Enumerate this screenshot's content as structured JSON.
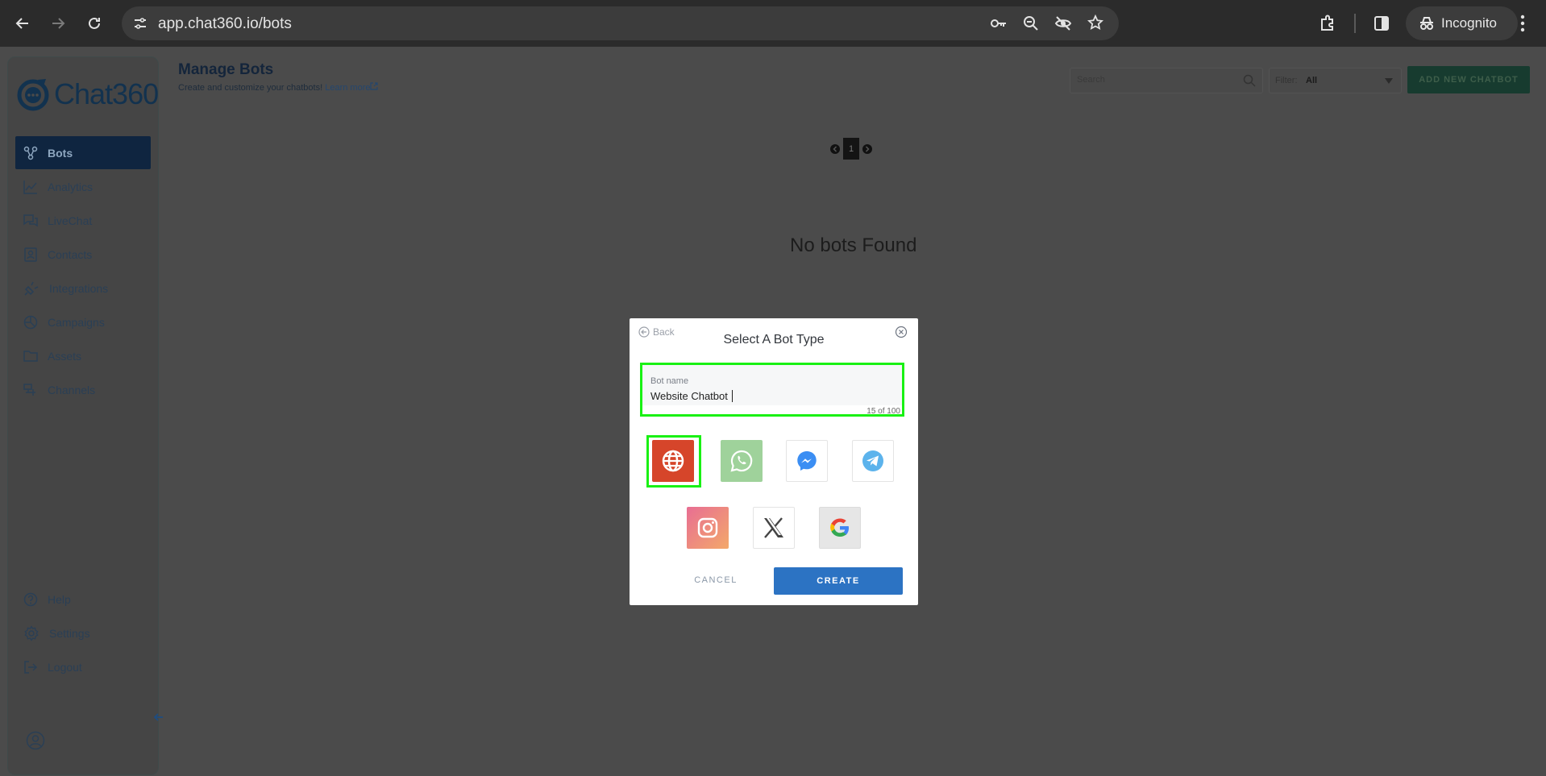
{
  "browser": {
    "url": "app.chat360.io/bots",
    "profile_label": "Incognito"
  },
  "brand": {
    "logo_text": "Chat360"
  },
  "sidebar": {
    "items": [
      {
        "label": "Bots",
        "icon": "bots-icon"
      },
      {
        "label": "Analytics",
        "icon": "analytics-icon"
      },
      {
        "label": "LiveChat",
        "icon": "livechat-icon"
      },
      {
        "label": "Contacts",
        "icon": "contacts-icon"
      },
      {
        "label": "Integrations",
        "icon": "plug-icon"
      },
      {
        "label": "Campaigns",
        "icon": "campaigns-icon"
      },
      {
        "label": "Assets",
        "icon": "folder-icon"
      },
      {
        "label": "Channels",
        "icon": "channels-icon"
      }
    ],
    "bottom_items": [
      {
        "label": "Help",
        "icon": "help-icon"
      },
      {
        "label": "Settings",
        "icon": "gear-icon"
      },
      {
        "label": "Logout",
        "icon": "logout-icon"
      }
    ]
  },
  "header": {
    "title": "Manage Bots",
    "subtitle": "Create and customize your chatbots!",
    "learn_more": "Learn more",
    "search_placeholder": "Search",
    "filter_label": "Filter:",
    "filter_value": "All",
    "add_button": "ADD NEW CHATBOT"
  },
  "pager": {
    "current_page": "1"
  },
  "main": {
    "empty_message": "No bots Found"
  },
  "modal": {
    "back_label": "Back",
    "title": "Select A Bot Type",
    "bot_name_label": "Bot name",
    "bot_name_value": "Website Chatbot",
    "char_count": "15 of 100",
    "bot_types": [
      "website",
      "whatsapp",
      "messenger",
      "telegram",
      "instagram",
      "x",
      "google"
    ],
    "selected_type": "website",
    "cancel_label": "CANCEL",
    "create_label": "CREATE"
  },
  "colors": {
    "highlight": "#19f114",
    "create_button": "#2c73c3",
    "website_tile": "#d6452a"
  }
}
